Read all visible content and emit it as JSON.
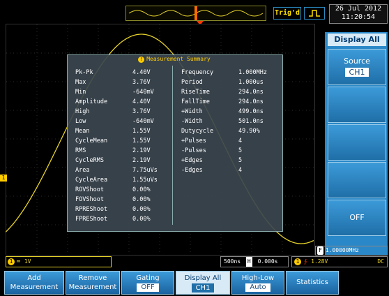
{
  "top": {
    "trig_status": "Trig'd",
    "date": "26 Jul 2012",
    "time": "11:20:54"
  },
  "summary": {
    "title": "Measurement Summary",
    "left": [
      {
        "label": "Pk-Pk",
        "value": "4.40V"
      },
      {
        "label": "Max",
        "value": "3.76V"
      },
      {
        "label": "Min",
        "value": "-640mV"
      },
      {
        "label": "Amplitude",
        "value": "4.40V"
      },
      {
        "label": "High",
        "value": "3.76V"
      },
      {
        "label": "Low",
        "value": "-640mV"
      },
      {
        "label": "Mean",
        "value": "1.55V"
      },
      {
        "label": "CycleMean",
        "value": "1.55V"
      },
      {
        "label": "RMS",
        "value": "2.19V"
      },
      {
        "label": "CycleRMS",
        "value": "2.19V"
      },
      {
        "label": "Area",
        "value": "7.75uVs"
      },
      {
        "label": "CycleArea",
        "value": "1.55uVs"
      },
      {
        "label": "ROVShoot",
        "value": "0.00%"
      },
      {
        "label": "FOVShoot",
        "value": "0.00%"
      },
      {
        "label": "RPREShoot",
        "value": "0.00%"
      },
      {
        "label": "FPREShoot",
        "value": "0.00%"
      }
    ],
    "right": [
      {
        "label": "Frequency",
        "value": "1.000MHz"
      },
      {
        "label": "Period",
        "value": "1.000us"
      },
      {
        "label": "RiseTime",
        "value": "294.0ns"
      },
      {
        "label": "FallTime",
        "value": "294.0ns"
      },
      {
        "label": "+Width",
        "value": "499.0ns"
      },
      {
        "label": "-Width",
        "value": "501.0ns"
      },
      {
        "label": "Dutycycle",
        "value": "49.90%"
      },
      {
        "label": "+Pulses",
        "value": "4"
      },
      {
        "label": "-Pulses",
        "value": "5"
      },
      {
        "label": "+Edges",
        "value": "5"
      },
      {
        "label": "-Edges",
        "value": "4"
      }
    ]
  },
  "right_menu": {
    "title": "Display All",
    "source_label": "Source",
    "source_value": "CH1",
    "off_label": "OFF"
  },
  "info": {
    "ch_scale": "1V",
    "timebase": "500ns",
    "h_marker": "H",
    "position": "0.000s",
    "trigger_level": "1.28V",
    "coupling": "DC",
    "freq_marker": "F",
    "frequency": "1.00000MHz"
  },
  "softkeys": {
    "add_line1": "Add",
    "add_line2": "Measurement",
    "remove_line1": "Remove",
    "remove_line2": "Measurement",
    "gating_label": "Gating",
    "gating_value": "OFF",
    "display_label": "Display All",
    "display_value": "CH1",
    "highlow_label": "High-Low",
    "highlow_value": "Auto",
    "statistics_label": "Statistics"
  },
  "colors": {
    "trace": "#e6d22a",
    "menu_blue": "#2a88c8",
    "accent_yellow": "#ffcc00"
  }
}
